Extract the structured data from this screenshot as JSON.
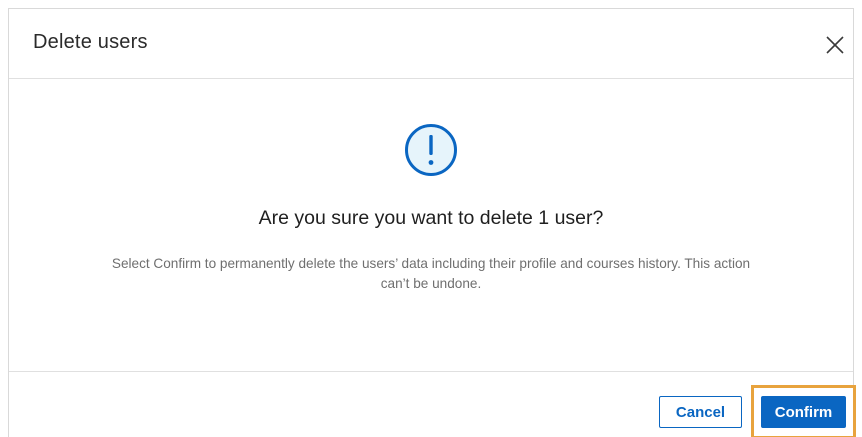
{
  "dialog": {
    "title": "Delete users",
    "close_icon": "close-icon",
    "warning_icon": "exclamation-circle-icon",
    "question": "Are you sure you want to delete 1 user?",
    "description": "Select Confirm to permanently delete the users’ data including their profile and courses history. This action can’t be undone."
  },
  "footer": {
    "cancel_label": "Cancel",
    "confirm_label": "Confirm"
  },
  "colors": {
    "accent": "#0a66c2",
    "highlight": "#e8a33d",
    "icon_fill": "#e6f4fb"
  }
}
